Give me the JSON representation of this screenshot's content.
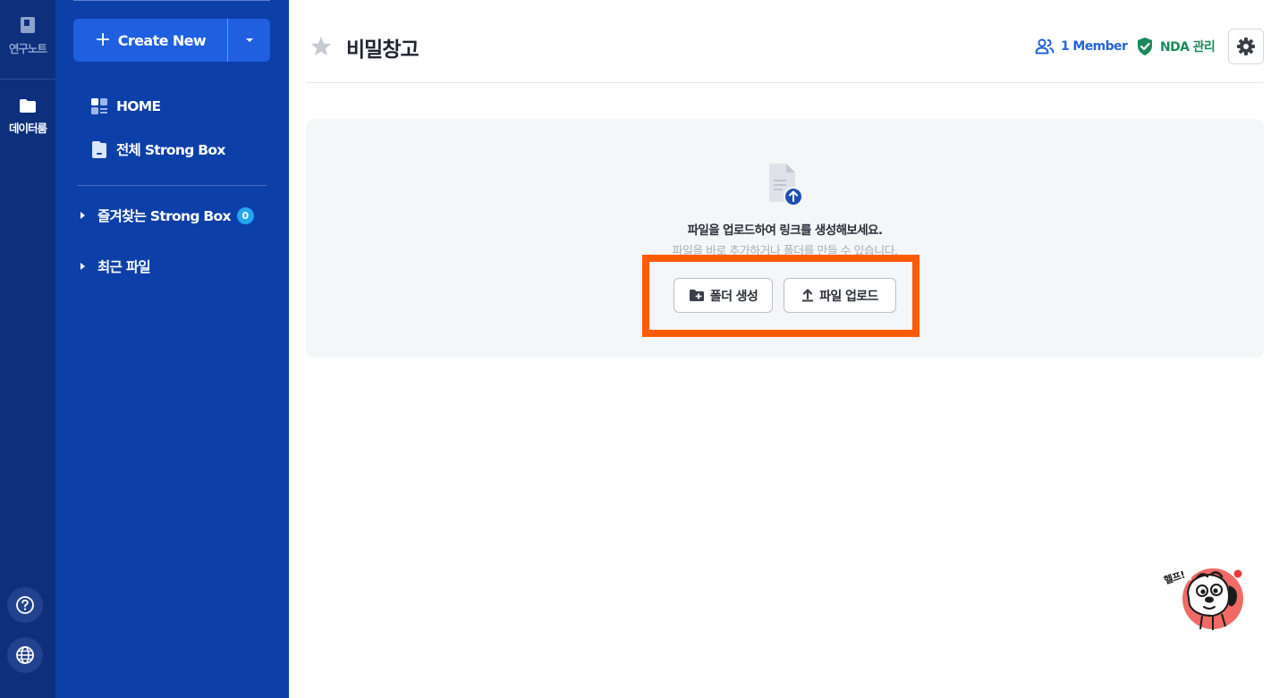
{
  "rail": {
    "notes_label": "연구노트",
    "data_label": "데이터룸"
  },
  "sidebar": {
    "create_label": "Create New",
    "nav": {
      "home": "HOME",
      "all_box": "전체 Strong Box"
    },
    "favorites": {
      "label": "즐겨찾는 Strong Box",
      "count": "0"
    },
    "recent_label": "최근 파일"
  },
  "header": {
    "title": "비밀창고",
    "member_label": "1 Member",
    "nda_label": "NDA 관리"
  },
  "empty_state": {
    "title": "파일을 업로드하여 링크를 생성해보세요.",
    "subtitle": "파일을 바로 추가하거나 폴더를 만들 수 있습니다.",
    "create_folder_label": "폴더 생성",
    "upload_label": "파일 업로드"
  },
  "help": {
    "label": "헬프!"
  },
  "colors": {
    "rail_bg": "#0d2f7c",
    "sidebar_bg": "#0d3fa8",
    "primary": "#1f5fe0",
    "highlight": "#ff5a06",
    "nda_green": "#1a8a5a",
    "member_blue": "#2465d8"
  }
}
